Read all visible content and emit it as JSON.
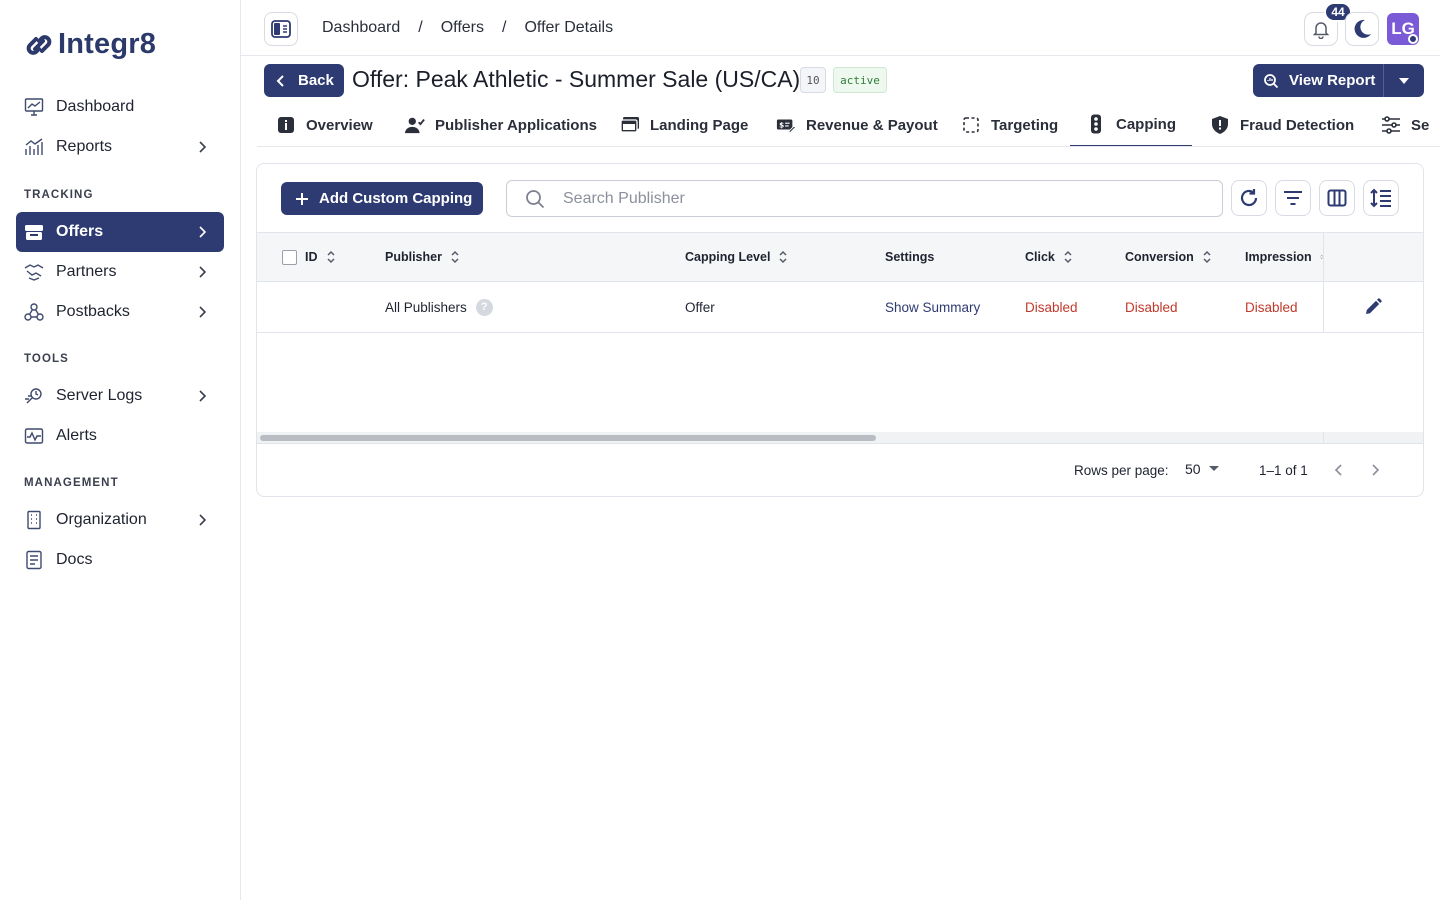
{
  "app": {
    "name": "Integr8"
  },
  "sidebar": {
    "items": [
      {
        "label": "Dashboard",
        "icon": "dashboard-icon"
      },
      {
        "label": "Reports",
        "icon": "reports-icon"
      },
      {
        "label": "Offers",
        "icon": "offers-icon"
      },
      {
        "label": "Partners",
        "icon": "partners-icon"
      },
      {
        "label": "Postbacks",
        "icon": "postbacks-icon"
      },
      {
        "label": "Server Logs",
        "icon": "server-logs-icon"
      },
      {
        "label": "Alerts",
        "icon": "alerts-icon"
      },
      {
        "label": "Organization",
        "icon": "organization-icon"
      },
      {
        "label": "Docs",
        "icon": "docs-icon"
      }
    ],
    "sections": {
      "tracking": "TRACKING",
      "tools": "TOOLS",
      "management": "MANAGEMENT"
    }
  },
  "topbar": {
    "breadcrumb": [
      "Dashboard",
      "Offers",
      "Offer Details"
    ],
    "separator": "/",
    "notifications_count": "44",
    "avatar_initials": "LG"
  },
  "header": {
    "back_label": "Back",
    "title": "Offer: Peak Athletic - Summer Sale (US/CA)",
    "offer_id": "10",
    "status": "active",
    "view_report_label": "View Report"
  },
  "tabs": [
    {
      "label": "Overview"
    },
    {
      "label": "Publisher Applications"
    },
    {
      "label": "Landing Page"
    },
    {
      "label": "Revenue & Payout"
    },
    {
      "label": "Targeting"
    },
    {
      "label": "Capping"
    },
    {
      "label": "Fraud Detection"
    },
    {
      "label": "Se"
    }
  ],
  "toolbar": {
    "add_label": "Add Custom Capping",
    "search_placeholder": "Search Publisher"
  },
  "table": {
    "columns": [
      "ID",
      "Publisher",
      "Capping Level",
      "Settings",
      "Click",
      "Conversion",
      "Impression"
    ],
    "rows": [
      {
        "id": "",
        "publisher": "All Publishers",
        "help": "?",
        "capping_level": "Offer",
        "settings": "Show Summary",
        "click": "Disabled",
        "conversion": "Disabled",
        "impression": "Disabled"
      }
    ]
  },
  "pagination": {
    "rows_per_page_label": "Rows per page:",
    "rows_per_page": "50",
    "range": "1–1 of 1"
  },
  "colors": {
    "primary": "#2e3b73",
    "danger": "#c0392b",
    "avatar": "#7a5ad6",
    "success": "#2f7d3a"
  }
}
